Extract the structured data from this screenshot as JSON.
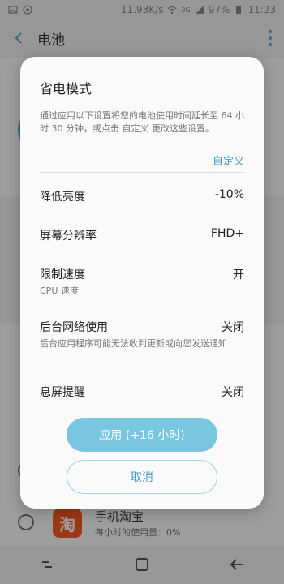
{
  "status_bar": {
    "speed": "11.93K/s",
    "signal": "3G",
    "battery": "97%",
    "time": "11:23"
  },
  "app_bar": {
    "title": "电池"
  },
  "background_app": {
    "name": "手机淘宝",
    "usage": "每小时的使用量：0%",
    "icon_text": "淘"
  },
  "dialog": {
    "title": "省电模式",
    "description": "通过应用以下设置将您的电池使用时间延长至 64 小时 30 分钟，或点击 自定义 更改这些设置。",
    "customize_label": "自定义",
    "options": [
      {
        "label": "降低亮度",
        "sub": "",
        "value": "-10%"
      },
      {
        "label": "屏幕分辨率",
        "sub": "",
        "value": "FHD+"
      },
      {
        "label": "限制速度",
        "sub": "CPU 速度",
        "value": "开"
      },
      {
        "label": "后台网络使用",
        "sub": "后台应用程序可能无法收到更新或向您发送通知",
        "value": "关闭"
      },
      {
        "label": "息屏提醒",
        "sub": "",
        "value": "关闭"
      }
    ],
    "apply_label": "应用 (+16 小时)",
    "cancel_label": "取消"
  },
  "colors": {
    "accent": "#3ea2c9",
    "apply_button": "#78c6df",
    "taobao": "#ff5a1f"
  }
}
